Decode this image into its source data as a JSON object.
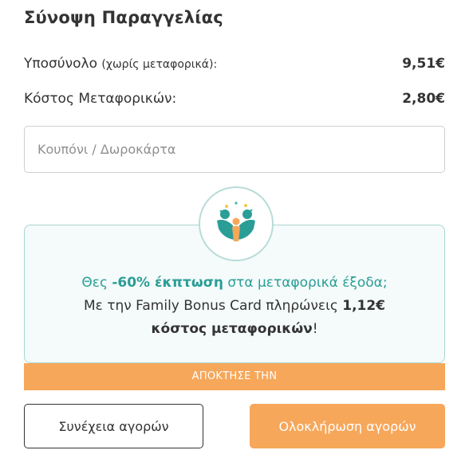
{
  "summary": {
    "title": "Σύνοψη Παραγγελίας",
    "subtotal_label": "Υποσύνολο",
    "subtotal_note": "(χωρίς μεταφορικά):",
    "subtotal_value": "9,51€",
    "shipping_label": "Κόστος Μεταφορικών:",
    "shipping_value": "2,80€"
  },
  "coupon": {
    "placeholder": "Κουπόνι / Δωροκάρτα",
    "value": ""
  },
  "promo": {
    "line1_pre": "Θες ",
    "line1_bold": "-60% έκπτωση",
    "line1_post": " στα μεταφορικά έξοδα;",
    "line2_pre": "Με την Family Bonus Card πληρώνεις ",
    "line2_bold": "1,12€",
    "line3_bold": "κόστος μεταφορικών",
    "line3_post": "!",
    "cta": "ΑΠΟΚΤΗΣΕ ΤΗΝ",
    "logo_icon": "family-logo-icon"
  },
  "actions": {
    "continue_label": "Συνέχεια αγορών",
    "complete_label": "Ολοκλήρωση αγορών"
  },
  "colors": {
    "accent_orange": "#f6a75a",
    "teal": "#2a9d96"
  }
}
